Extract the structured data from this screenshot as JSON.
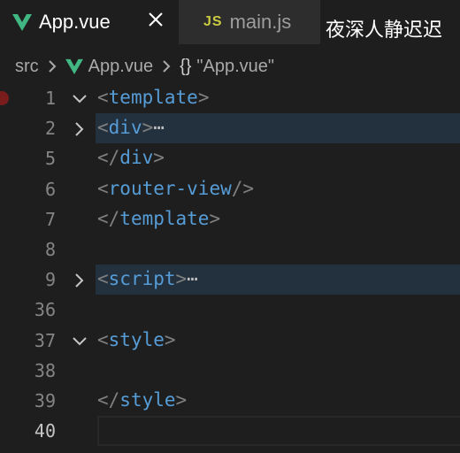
{
  "tabs": [
    {
      "label": "App.vue",
      "icon": "vue-icon",
      "active": true
    },
    {
      "label": "main.js",
      "icon": "js-icon",
      "icon_text": "JS",
      "active": false
    }
  ],
  "window_title": "夜深人静迟迟",
  "breadcrumb": {
    "folder": "src",
    "file": "App.vue",
    "braces": "{}",
    "symbol": "\"App.vue\""
  },
  "lines": [
    {
      "num": "1",
      "fold": "expanded",
      "open": "<",
      "tag": "template",
      "close": ">",
      "ellipsis": "",
      "breakpoint": true
    },
    {
      "num": "2",
      "fold": "collapsed",
      "open": "<",
      "tag": "div",
      "close": ">",
      "ellipsis": "⋯",
      "highlight": true
    },
    {
      "num": "5",
      "fold": "",
      "open": "</",
      "tag": "div",
      "close": ">",
      "ellipsis": ""
    },
    {
      "num": "6",
      "fold": "",
      "open": "<",
      "tag": "router-view",
      "close": "/>",
      "ellipsis": ""
    },
    {
      "num": "7",
      "fold": "",
      "open": "</",
      "tag": "template",
      "close": ">",
      "ellipsis": ""
    },
    {
      "num": "8",
      "fold": "",
      "open": "",
      "tag": "",
      "close": "",
      "ellipsis": ""
    },
    {
      "num": "9",
      "fold": "collapsed",
      "open": "<",
      "tag": "script",
      "close": ">",
      "ellipsis": "⋯",
      "highlight": true
    },
    {
      "num": "36",
      "fold": "",
      "open": "",
      "tag": "",
      "close": "",
      "ellipsis": ""
    },
    {
      "num": "37",
      "fold": "expanded",
      "open": "<",
      "tag": "style",
      "close": ">",
      "ellipsis": ""
    },
    {
      "num": "38",
      "fold": "",
      "open": "",
      "tag": "",
      "close": "",
      "ellipsis": ""
    },
    {
      "num": "39",
      "fold": "",
      "open": "</",
      "tag": "style",
      "close": ">",
      "ellipsis": ""
    },
    {
      "num": "40",
      "fold": "",
      "open": "",
      "tag": "",
      "close": "",
      "ellipsis": "",
      "current": true
    }
  ],
  "colors": {
    "editor_bg": "#1e1e1e",
    "tag": "#569cd6",
    "punctuation": "#808080",
    "vue_green": "#41b883",
    "js_yellow": "#cbcb41",
    "fold_highlight": "#23313f",
    "breakpoint": "#7a1c1c"
  }
}
